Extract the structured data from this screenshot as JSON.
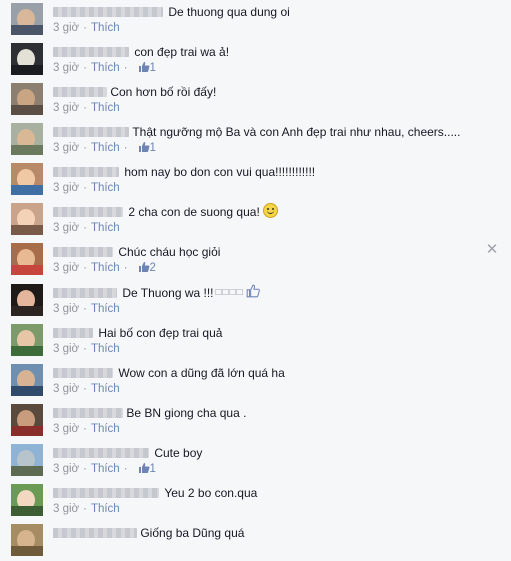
{
  "icons": {
    "like": "thumbs-up-icon",
    "close": "close-x-icon",
    "smile": "smile-emoji-icon"
  },
  "colors": {
    "link": "#6d84b4",
    "meta": "#90949c",
    "text": "#141823",
    "background": "#f6f7f9"
  },
  "ui": {
    "close_glyph": "✕"
  },
  "comments": [
    {
      "text": "De thuong qua dung oi",
      "time": "3 giờ",
      "like": "Thích",
      "likes": null
    },
    {
      "text": "con đẹp trai wa ả!",
      "time": "3 giờ",
      "like": "Thích",
      "likes": "1"
    },
    {
      "text": "Con hơn bố rồi đấy!",
      "time": "3 giờ",
      "like": "Thích",
      "likes": null
    },
    {
      "text": "Thật ngưỡng mộ Ba và con Anh đẹp trai như nhau, cheers.....",
      "time": "3 giờ",
      "like": "Thích",
      "likes": "1"
    },
    {
      "text": "hom nay bo don con vui qua!!!!!!!!!!!!",
      "time": "3 giờ",
      "like": "Thích",
      "likes": null
    },
    {
      "text": "2 cha con de suong qua!",
      "time": "3 giờ",
      "like": "Thích",
      "likes": null
    },
    {
      "text": "Chúc cháu học giỏi",
      "time": "3 giờ",
      "like": "Thích",
      "likes": "2"
    },
    {
      "text": "De Thuong wa !!!",
      "time": "3 giờ",
      "like": "Thích",
      "likes": null
    },
    {
      "text": "Hai bố con đẹp trai quả",
      "time": "3 giờ",
      "like": "Thích",
      "likes": null
    },
    {
      "text": "Wow con a dũng đã lớn quá ha",
      "time": "3 giờ",
      "like": "Thích",
      "likes": null
    },
    {
      "text": "Be BN giong cha qua .",
      "time": "3 giờ",
      "like": "Thích",
      "likes": null
    },
    {
      "text": "Cute boy",
      "time": "3 giờ",
      "like": "Thích",
      "likes": "1"
    },
    {
      "text": "Yeu 2 bo con.qua",
      "time": "3 giờ",
      "like": "Thích",
      "likes": null
    },
    {
      "text": "Giống ba Dũng quá",
      "time": "3 giờ",
      "like": "Thích",
      "likes": null
    }
  ]
}
